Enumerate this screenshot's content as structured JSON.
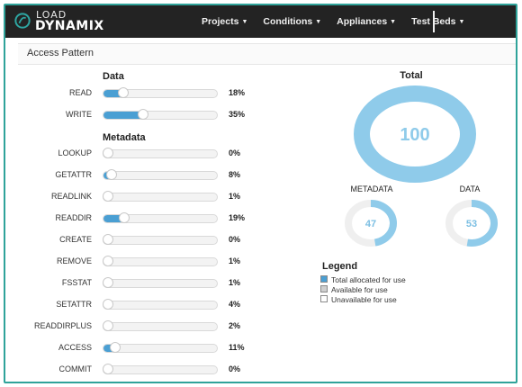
{
  "app": {
    "logo_top": "LOAD",
    "logo_bottom": "DYNAMIX"
  },
  "nav": {
    "items": [
      {
        "label": "Projects"
      },
      {
        "label": "Conditions"
      },
      {
        "label": "Appliances"
      },
      {
        "label": "Test Beds"
      }
    ]
  },
  "page": {
    "title": "Access Pattern"
  },
  "data_section": {
    "title": "Data",
    "rows": [
      {
        "label": "READ",
        "value": 18,
        "display": "18%"
      },
      {
        "label": "WRITE",
        "value": 35,
        "display": "35%"
      }
    ]
  },
  "metadata_section": {
    "title": "Metadata",
    "rows": [
      {
        "label": "LOOKUP",
        "value": 0,
        "display": "0%"
      },
      {
        "label": "GETATTR",
        "value": 8,
        "display": "8%"
      },
      {
        "label": "READLINK",
        "value": 1,
        "display": "1%"
      },
      {
        "label": "READDIR",
        "value": 19,
        "display": "19%"
      },
      {
        "label": "CREATE",
        "value": 0,
        "display": "0%"
      },
      {
        "label": "REMOVE",
        "value": 1,
        "display": "1%"
      },
      {
        "label": "FSSTAT",
        "value": 1,
        "display": "1%"
      },
      {
        "label": "SETATTR",
        "value": 4,
        "display": "4%"
      },
      {
        "label": "READDIRPLUS",
        "value": 2,
        "display": "2%"
      },
      {
        "label": "ACCESS",
        "value": 11,
        "display": "11%"
      },
      {
        "label": "COMMIT",
        "value": 0,
        "display": "0%"
      }
    ]
  },
  "total": {
    "title": "Total",
    "value": "100",
    "fraction": 1.0
  },
  "metadata_donut": {
    "title": "METADATA",
    "value": "47",
    "fraction": 0.47
  },
  "data_donut": {
    "title": "DATA",
    "value": "53",
    "fraction": 0.53
  },
  "legend": {
    "title": "Legend",
    "items": [
      {
        "label": "Total allocated for use",
        "color": "#4a9fd3"
      },
      {
        "label": "Available for use",
        "color": "#cfcfcf"
      },
      {
        "label": "Unavailable for use",
        "color": "#ffffff"
      }
    ]
  },
  "colors": {
    "accent": "#4a9fd3",
    "donut_ring": "#8fcbea",
    "donut_text": "#8fcbea",
    "track": "#efefef",
    "frame": "#2fa39a"
  }
}
